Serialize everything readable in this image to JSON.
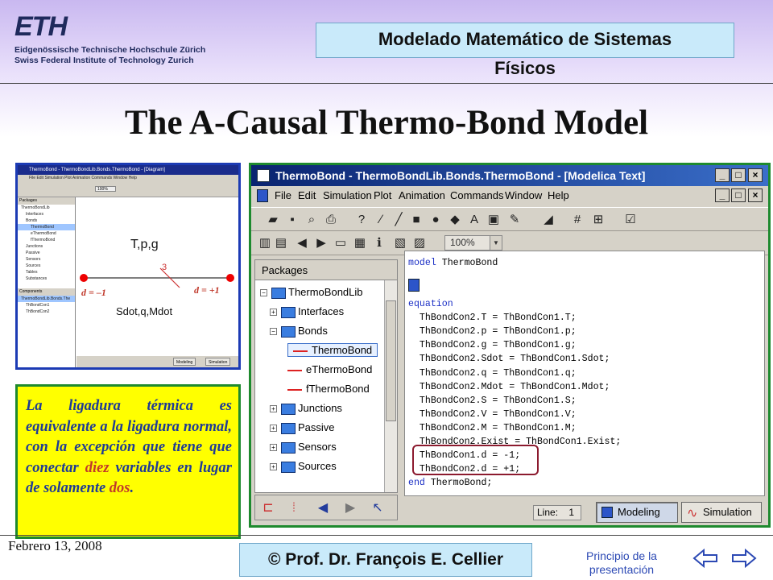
{
  "header": {
    "logo_word": "ETH",
    "logo_line1": "Eidgenössische Technische Hochschule Zürich",
    "logo_line2": "Swiss Federal Institute of Technology Zurich",
    "course_title_line1": "Modelado Matemático de Sistemas",
    "course_title_line2": "Físicos"
  },
  "slide": {
    "title": "The A-Causal Thermo-Bond Model"
  },
  "small_screenshot": {
    "title": "ThermoBond - ThermoBondLib.Bonds.ThermoBond - [Diagram]",
    "menu": "File  Edit  Simulation  Plot  Animation  Commands  Window  Help",
    "zoom": "100%",
    "packages_label": "Packages",
    "tree": [
      "ThermoBondLib",
      "Interfaces",
      "Bonds",
      "ThermoBond",
      "eThermoBond",
      "fThermoBond",
      "Junctions",
      "Passive",
      "Sensors",
      "Sources",
      "Tables",
      "Substances"
    ],
    "components_label": "Components",
    "components": [
      "ThermoBondLib.Bonds.The",
      "ThBondCon1",
      "ThBondCon2"
    ],
    "diagram": {
      "top_label": "T,p,g",
      "bond_index": "3",
      "bottom_label": "Sdot,q,Mdot",
      "left_direction": "d = –1",
      "right_direction": "d = +1"
    },
    "modeling_btn": "Modeling",
    "simulation_btn": "Simulation"
  },
  "explanation": {
    "part1": "La ligadura térmica es equivalente a la ligadura normal, con la excepción que tiene que conectar ",
    "em1": "diez",
    "part2": " variables en lugar de solamente ",
    "em2": "dos",
    "part3": "."
  },
  "main_window": {
    "title": "ThermoBond - ThermoBondLib.Bonds.ThermoBond - [Modelica Text]",
    "menu": [
      "File",
      "Edit",
      "Simulation",
      "Plot",
      "Animation",
      "Commands",
      "Window",
      "Help"
    ],
    "zoom_value": "100%",
    "packages_header": "Packages",
    "tree": [
      {
        "label": "ThermoBondLib",
        "icon": "folder-icon"
      },
      {
        "label": "Interfaces",
        "icon": "folder-icon"
      },
      {
        "label": "Bonds",
        "icon": "folder-icon"
      },
      {
        "label": "ThermoBond",
        "icon": "bond-icon"
      },
      {
        "label": "eThermoBond",
        "icon": "bond-icon"
      },
      {
        "label": "fThermoBond",
        "icon": "bond-icon"
      },
      {
        "label": "Junctions",
        "icon": "folder-icon"
      },
      {
        "label": "Passive",
        "icon": "folder-icon"
      },
      {
        "label": "Sensors",
        "icon": "folder-icon"
      },
      {
        "label": "Sources",
        "icon": "folder-icon"
      }
    ],
    "code": {
      "l1_kw": "model",
      "l1_rest": " ThermoBond",
      "l2_kw": "equation",
      "eqs": [
        "  ThBondCon2.T = ThBondCon1.T;",
        "  ThBondCon2.p = ThBondCon1.p;",
        "  ThBondCon2.g = ThBondCon1.g;",
        "  ThBondCon2.Sdot = ThBondCon1.Sdot;",
        "  ThBondCon2.q = ThBondCon1.q;",
        "  ThBondCon2.Mdot = ThBondCon1.Mdot;",
        "  ThBondCon2.S = ThBondCon1.S;",
        "  ThBondCon2.V = ThBondCon1.V;",
        "  ThBondCon2.M = ThBondCon1.M;",
        "  ThBondCon2.Exist = ThBondCon1.Exist;",
        "  ThBondCon1.d = -1;",
        "  ThBondCon2.d = +1;"
      ],
      "end_kw": "end",
      "end_rest": " ThermoBond;"
    },
    "status": {
      "line_label": "Line:",
      "line_value": "1",
      "modeling_label": "Modeling",
      "simulation_label": "Simulation"
    }
  },
  "footer": {
    "date": "Febrero 13, 2008",
    "copyright": "© Prof. Dr. François E. Cellier",
    "home_link": "Principio de la presentación"
  }
}
